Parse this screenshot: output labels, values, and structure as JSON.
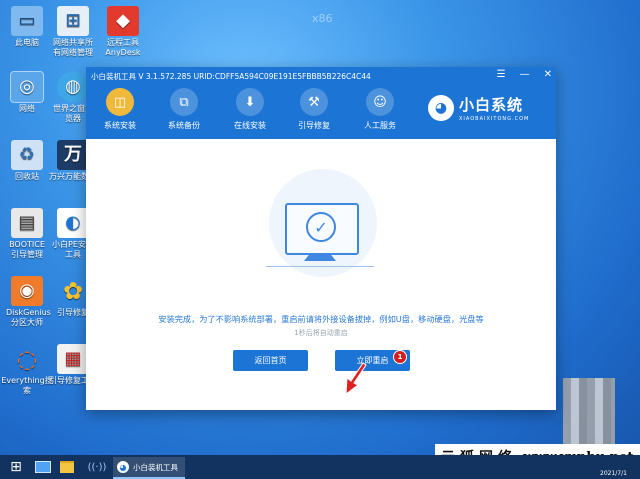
{
  "desktop": {
    "watermark": "x86",
    "icons": [
      {
        "label": "此电脑",
        "glyph": "▭"
      },
      {
        "label": "网络",
        "glyph": "◎"
      },
      {
        "label": "回收站",
        "glyph": "♻"
      },
      {
        "label": "BOOTICE引导管理",
        "glyph": "▤"
      },
      {
        "label": "DiskGenius分区大师",
        "glyph": "◉"
      },
      {
        "label": "Everything搜索",
        "glyph": "◌"
      },
      {
        "label": "网络共享所有网络管理",
        "glyph": "⊞"
      },
      {
        "label": "世界之窗浏览器",
        "glyph": "◍"
      },
      {
        "label": "万兴万能数据",
        "glyph": "万"
      },
      {
        "label": "小白PE安装工具",
        "glyph": "◐"
      },
      {
        "label": "引导修复",
        "glyph": "✿"
      },
      {
        "label": "引导修复工具",
        "glyph": "▦"
      },
      {
        "label": "远程工具AnyDesk",
        "glyph": "◆"
      }
    ]
  },
  "window": {
    "title": "小白装机工具 V 3.1.572.285 URID:CDFF5A594C09E191E5FBBB5B226C4C44",
    "controls": {
      "menu": "☰",
      "minimize": "—",
      "close": "✕"
    },
    "tabs": [
      {
        "label": "系统安装",
        "glyph": "◫"
      },
      {
        "label": "系统备份",
        "glyph": "⧉"
      },
      {
        "label": "在线安装",
        "glyph": "⬇"
      },
      {
        "label": "引导修复",
        "glyph": "⚒"
      },
      {
        "label": "人工服务",
        "glyph": "☺"
      }
    ],
    "brand": {
      "name": "小白系统",
      "sub": "XIAOBAIXITONG.COM",
      "logo": "◕"
    },
    "message": "安装完成，为了不影响系统部署，重启前请将外接设备拔掉，例如U盘，移动硬盘，光盘等",
    "countdown": "1秒后将自动重启",
    "buttons": {
      "back": "返回首页",
      "restart": "立即重启"
    },
    "badge": "1",
    "check_glyph": "✓"
  },
  "taskbar": {
    "start_glyph": "⊞",
    "task_label": "小白装机工具",
    "date": "2021/7/1",
    "colors": {
      "bar": "#12335f",
      "accent": "#1c74d4"
    }
  },
  "watermark_site": {
    "cn": "云狐网络",
    "url": "www.yunhu.net"
  }
}
